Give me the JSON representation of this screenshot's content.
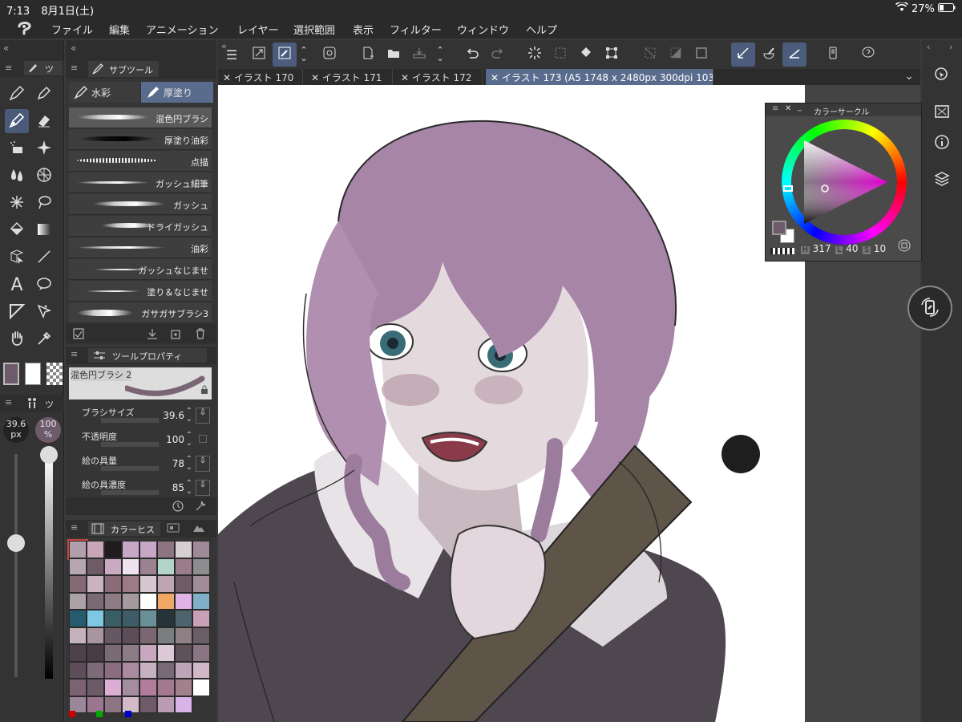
{
  "statusbar": {
    "time": "7:13",
    "date": "8月1日(土)",
    "battery": "27%"
  },
  "menu": {
    "items": [
      "ファイル",
      "編集",
      "アニメーション",
      "レイヤー",
      "選択範囲",
      "表示",
      "フィルター",
      "ウィンドウ",
      "ヘルプ"
    ]
  },
  "toolpanel": {
    "header_label": "ツ",
    "size_value": "39.6",
    "size_unit": "px",
    "opacity_value": "100",
    "opacity_unit": "%",
    "sub_header_label": "ツ"
  },
  "subtool": {
    "title": "サブツール",
    "tabs": [
      "水彩",
      "厚塗り"
    ],
    "brushes": [
      "混色円ブラシ",
      "厚塗り油彩",
      "点描",
      "ガッシュ細筆",
      "ガッシュ",
      "ドライガッシュ",
      "油彩",
      "ガッシュなじませ",
      "塗り＆なじませ",
      "ガサガサブラシ3"
    ]
  },
  "toolprop": {
    "title": "ツールプロパティ",
    "brush_name": "混色円ブラシ 2",
    "props": [
      {
        "label": "ブラシサイズ",
        "value": "39.6"
      },
      {
        "label": "不透明度",
        "value": "100"
      },
      {
        "label": "絵の具量",
        "value": "78"
      },
      {
        "label": "絵の具濃度",
        "value": "85"
      }
    ]
  },
  "colorhistory": {
    "title": "カラーヒス",
    "swatches": [
      "#b1a0ab",
      "#c9a5b9",
      "#1f1b1e",
      "#c7a7c6",
      "#c7a7c6",
      "#8c7580",
      "#d6d0d3",
      "#9f8b98",
      "#b6a6af",
      "#6e5b66",
      "#caaac0",
      "#efe2ee",
      "#9c8290",
      "#b2d4c9",
      "#9a7c8b",
      "#8d8c8e",
      "#836a75",
      "#c8b3be",
      "#8b6b75",
      "#9d7b86",
      "#d7c7cf",
      "#bea5b1",
      "#6f5c67",
      "#a18b97",
      "#aca1a7",
      "#7a6a73",
      "#8e7b84",
      "#a69aa0",
      "#ffffff",
      "#f0a765",
      "#e0b2e6",
      "#7fb0c8",
      "#265a6c",
      "#7ec8e3",
      "#385e66",
      "#3e5c68",
      "#698f99",
      "#263338",
      "#4d646c",
      "#c8a0b8",
      "#c5b2bc",
      "#a795a0",
      "#655862",
      "#5c4e58",
      "#7b6771",
      "#7a7e7f",
      "#8f8086",
      "#6b5d66",
      "#4e4149",
      "#4a3c44",
      "#7a6a74",
      "#8b7c85",
      "#c9a8bf",
      "#ddc8d6",
      "#5f515a",
      "#8c7583",
      "#5d4d59",
      "#7e6b78",
      "#8b6c80",
      "#a98aa0",
      "#c7b0c2",
      "#796977",
      "#bba5b6",
      "#d2b7c6",
      "#7b6373",
      "#6c5a66",
      "#dcaed4",
      "#a58da0",
      "#b07d9a",
      "#a4788f",
      "#a2808c",
      "#ffffff",
      "#9b879a",
      "#9c7690",
      "#8d7586",
      "#d2bac8",
      "#6d5b68",
      "#bb9ab4",
      "#d8b4e8"
    ]
  },
  "tabs": [
    "イラスト 170",
    "イラスト 171",
    "イラスト 172",
    "イラスト 173 (A5 1748 x 2480px 300dpi 103.2%)"
  ],
  "colorcircle": {
    "title": "カラーサークル",
    "h_label": "H",
    "h_value": "317",
    "l_label": "L",
    "l_value": "40",
    "s_label": "S",
    "s_value": "10"
  },
  "colors": {
    "main_color": "#6d5a6a",
    "sub_color": "#ffffff",
    "accent": "#5a6c8e"
  }
}
